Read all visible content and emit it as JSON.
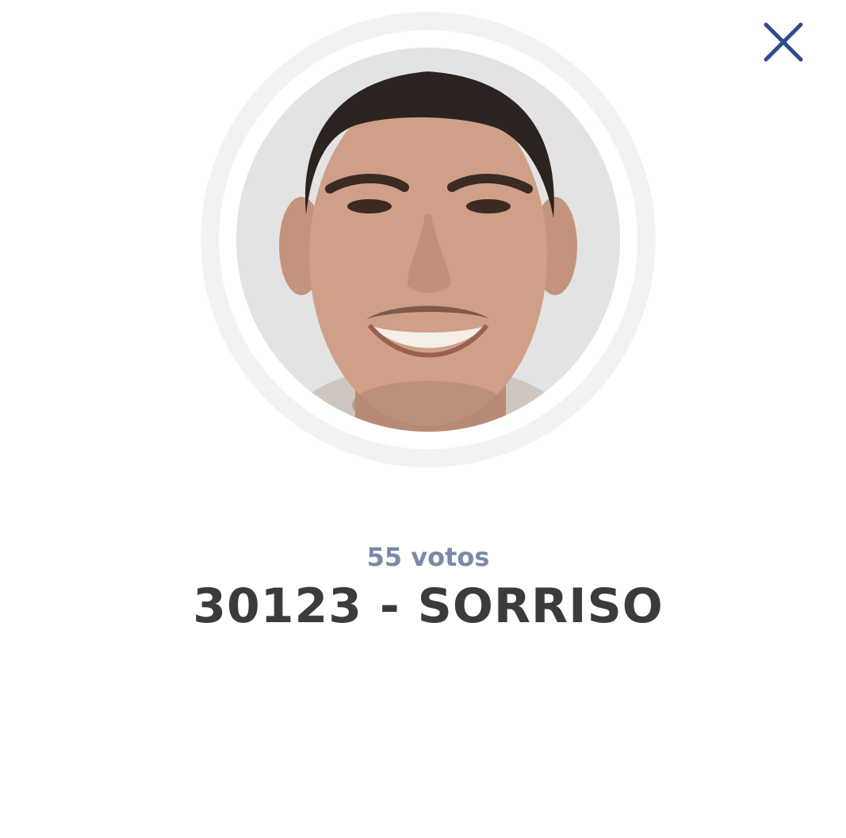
{
  "candidate": {
    "votes_label": "55 votos",
    "title": "30123 - SORRISO"
  },
  "icons": {
    "close": "close-icon",
    "avatar": "candidate-photo"
  },
  "colors": {
    "close_icon": "#2f4a8e",
    "votes_text": "#7a8aa8",
    "title_text": "#3b3b3b",
    "avatar_ring": "#f2f2f2",
    "background": "#ffffff"
  }
}
